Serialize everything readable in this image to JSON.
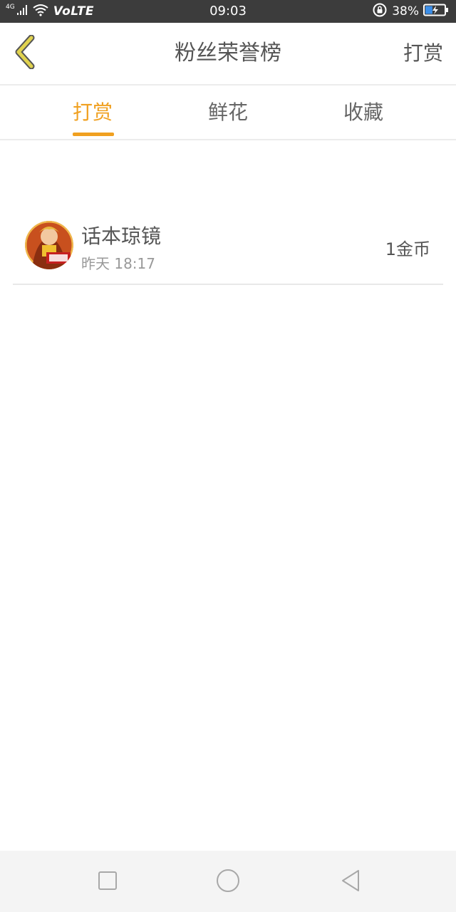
{
  "status_bar": {
    "network_label": "4G",
    "volte_label": "VoLTE",
    "time": "09:03",
    "battery_percent": "38%",
    "battery_level": 0.38,
    "background_color": "#3c3c3c"
  },
  "header": {
    "title": "粉丝荣誉榜",
    "action_label": "打赏",
    "back_icon": "chevron-left-icon",
    "back_color": "#d8c84a"
  },
  "tabs": [
    {
      "label": "打赏",
      "active": true
    },
    {
      "label": "鲜花",
      "active": false
    },
    {
      "label": "收藏",
      "active": false
    }
  ],
  "accent_color": "#f0a020",
  "list": [
    {
      "name": "话本琼镜",
      "time": "昨天 18:17",
      "amount": "1金币",
      "avatar_icon": "user-avatar-image"
    }
  ],
  "nav_bar": {
    "items": [
      "recents-square-icon",
      "home-circle-icon",
      "back-triangle-icon"
    ]
  }
}
